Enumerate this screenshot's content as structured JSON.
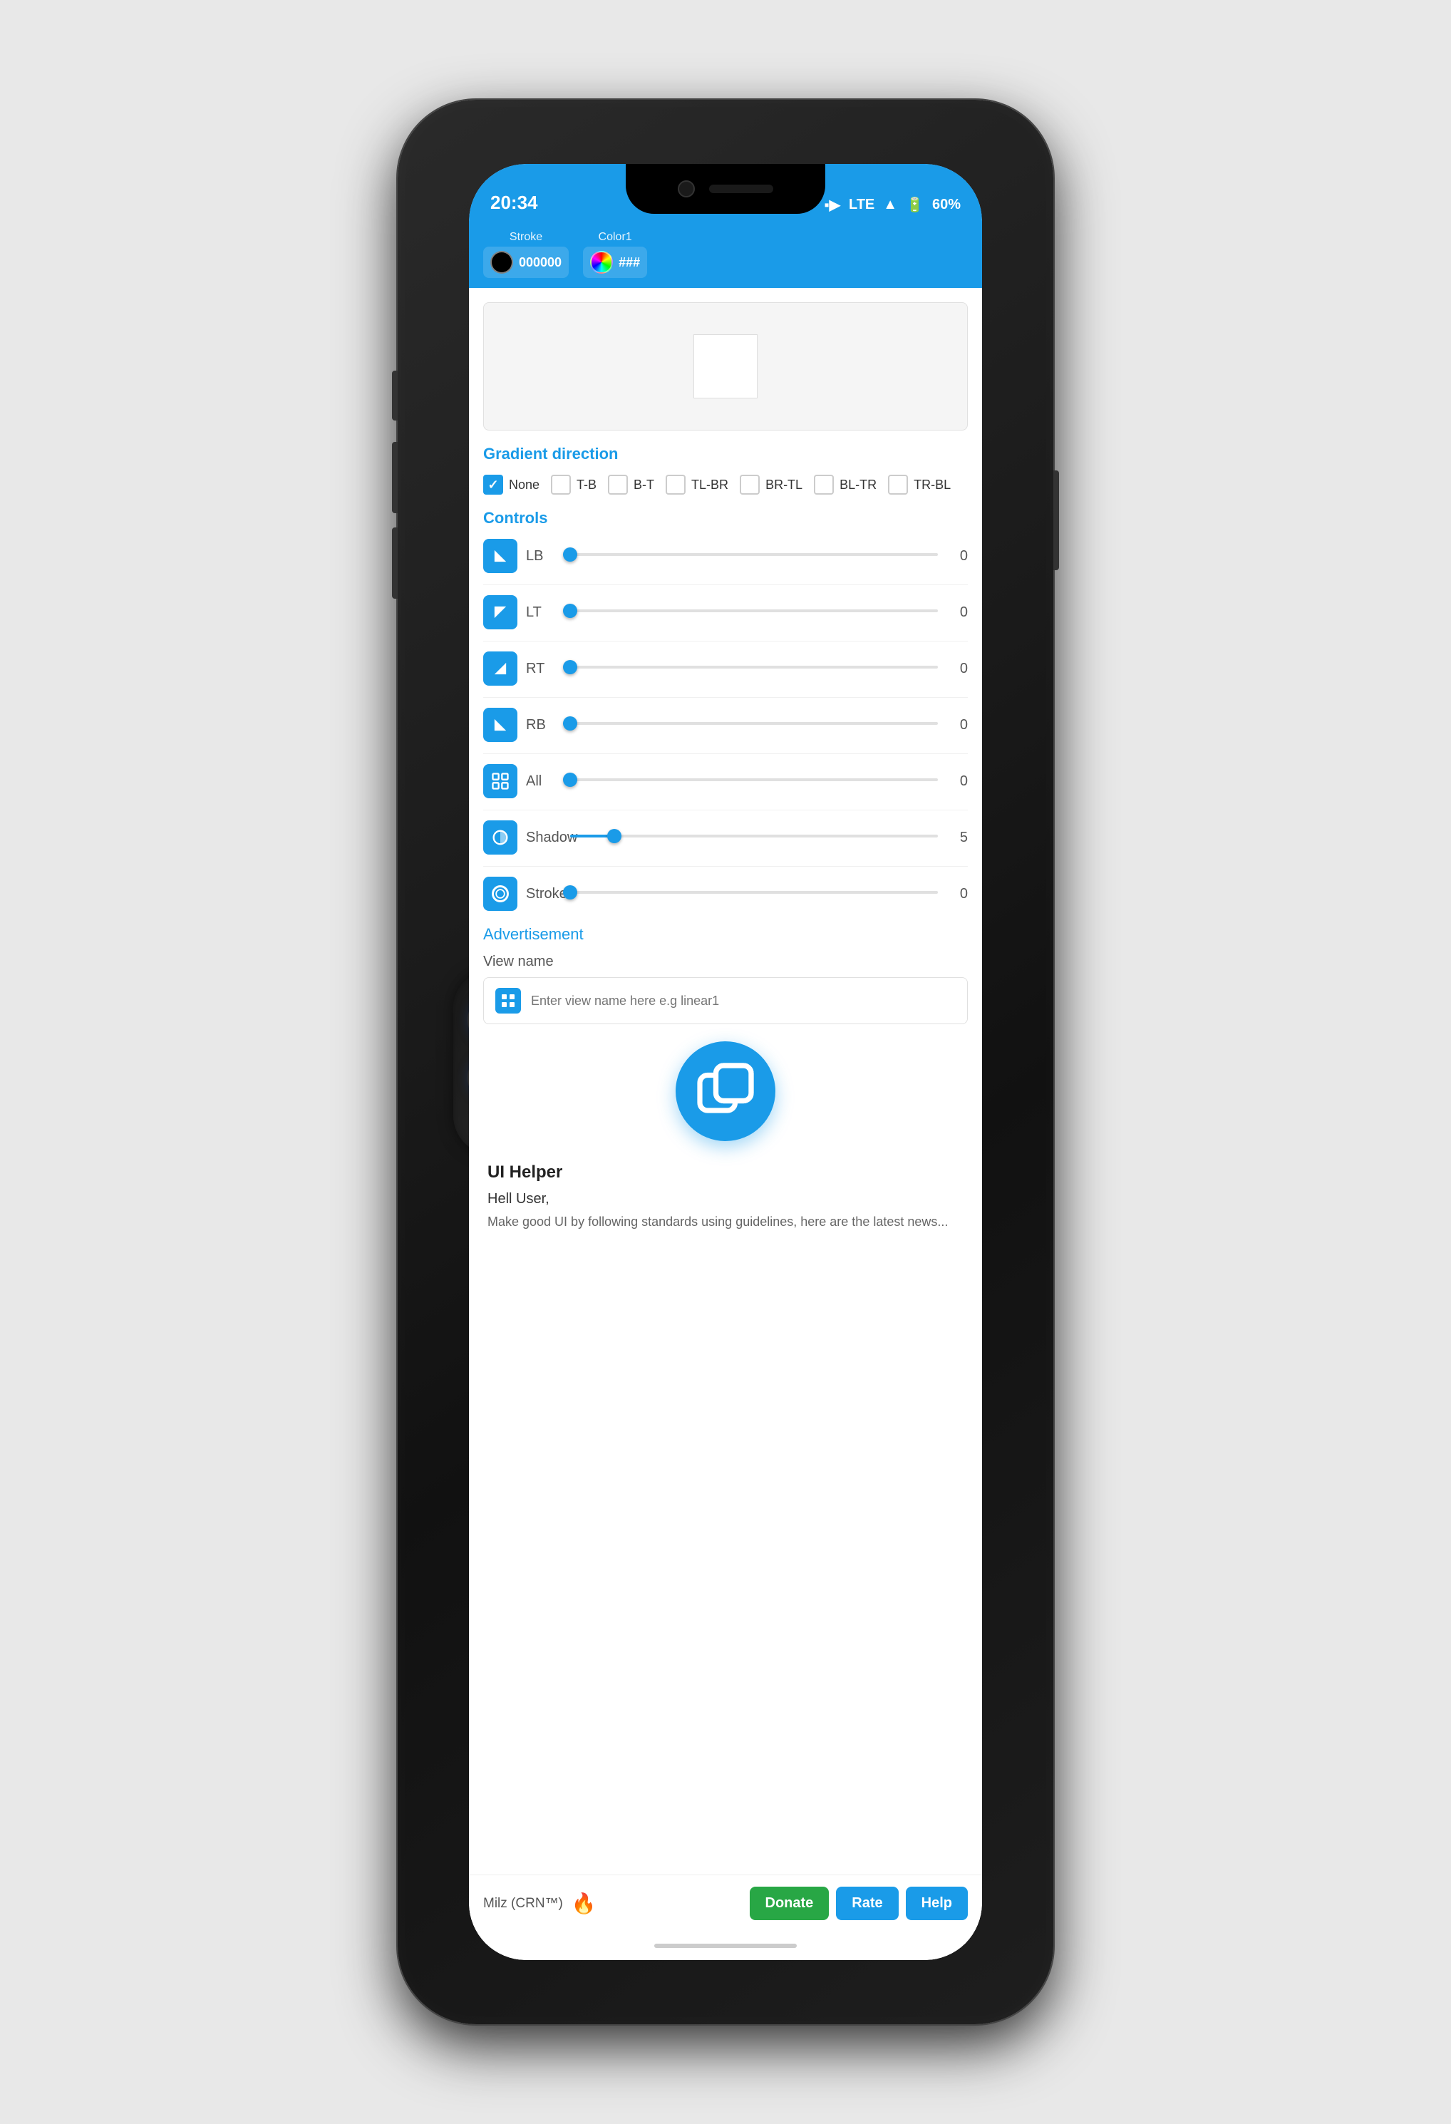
{
  "phone": {
    "status_bar": {
      "time": "20:34",
      "lte_label": "LTE",
      "battery": "60%"
    },
    "toolbar": {
      "stroke_label": "Stroke",
      "stroke_color": "000000",
      "color1_label": "Color1",
      "color1_value": "###"
    },
    "gradient": {
      "title": "Gradient direction",
      "options": [
        {
          "label": "None",
          "checked": true
        },
        {
          "label": "T-B",
          "checked": false
        },
        {
          "label": "B-T",
          "checked": false
        },
        {
          "label": "TL-BR",
          "checked": false
        },
        {
          "label": "BR-TL",
          "checked": false
        },
        {
          "label": "BL-TR",
          "checked": false
        },
        {
          "label": "TR-BL",
          "checked": false
        }
      ]
    },
    "controls": {
      "title": "Controls",
      "items": [
        {
          "id": "lb",
          "label": "LB",
          "value": 0,
          "thumb_pct": 0
        },
        {
          "id": "lt",
          "label": "LT",
          "value": 0,
          "thumb_pct": 0
        },
        {
          "id": "rt",
          "label": "RT",
          "value": 0,
          "thumb_pct": 0
        },
        {
          "id": "rb",
          "label": "RB",
          "value": 0,
          "thumb_pct": 0
        },
        {
          "id": "all",
          "label": "All",
          "value": 0,
          "thumb_pct": 0
        },
        {
          "id": "shadow",
          "label": "Shadow",
          "value": 5,
          "thumb_pct": 12
        },
        {
          "id": "stroke",
          "label": "Stroke",
          "value": 0,
          "thumb_pct": 0
        }
      ]
    },
    "advertisement_label": "Advertisement",
    "view_name": {
      "label": "View name",
      "placeholder": "Enter view name here e.g linear1"
    },
    "ui_helper": {
      "title": "UI Helper",
      "greeting": "Hell User,",
      "body_text": "Make good UI by following standards using guidelines, here are the latest news..."
    },
    "bottom_bar": {
      "brand": "Milz (CRN™)",
      "donate_label": "Donate",
      "rate_label": "Rate",
      "help_label": "Help"
    }
  }
}
